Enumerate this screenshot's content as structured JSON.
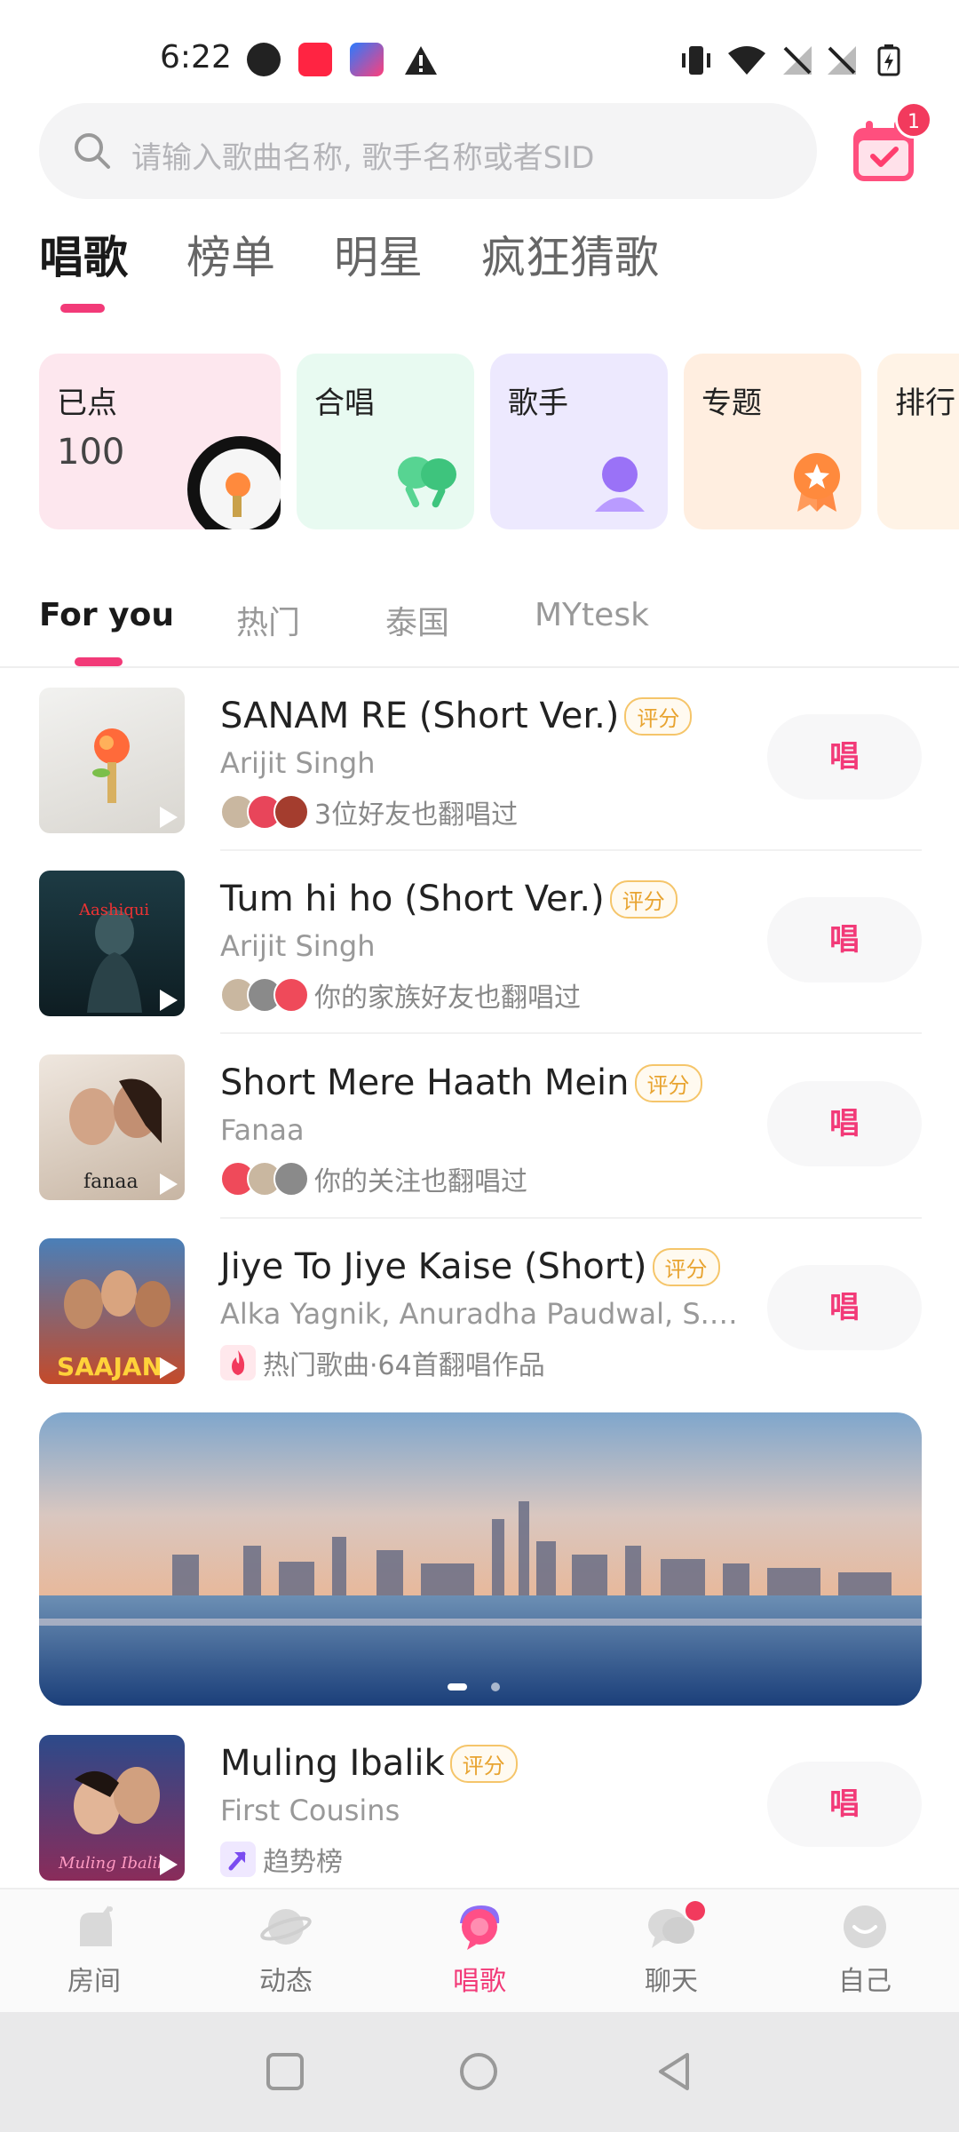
{
  "status_bar": {
    "time": "6:22"
  },
  "search": {
    "placeholder": "请输入歌曲名称, 歌手名称或者SID"
  },
  "calendar": {
    "badge": "1"
  },
  "main_tabs": [
    "唱歌",
    "榜单",
    "明星",
    "疯狂猜歌"
  ],
  "categories": [
    {
      "label": "已点",
      "count": "100"
    },
    {
      "label": "合唱"
    },
    {
      "label": "歌手"
    },
    {
      "label": "专题"
    },
    {
      "label": "排行"
    }
  ],
  "sub_tabs": [
    "For you",
    "热门",
    "泰国",
    "MYtesk"
  ],
  "songs": [
    {
      "title": "SANAM RE (Short Ver.)",
      "badge": "评分",
      "artist": "Arijit Singh",
      "meta": "3位好友也翻唱过",
      "action": "唱"
    },
    {
      "title": "Tum hi ho (Short Ver.)",
      "badge": "评分",
      "artist": "Arijit Singh",
      "meta": "你的家族好友也翻唱过",
      "action": "唱"
    },
    {
      "title": "Short Mere Haath Mein",
      "badge": "评分",
      "artist": "Fanaa",
      "meta": "你的关注也翻唱过",
      "action": "唱"
    },
    {
      "title": "Jiye To Jiye Kaise (Short)",
      "badge": "评分",
      "artist": "Alka Yagnik, Anuradha Paudwal, S. P. ...",
      "meta": "热门歌曲·64首翻唱作品",
      "action": "唱"
    },
    {
      "title": "Muling Ibalik",
      "badge": "评分",
      "artist": "First Cousins",
      "meta": "趋势榜",
      "action": "唱"
    }
  ],
  "bottom_nav": [
    "房间",
    "动态",
    "唱歌",
    "聊天",
    "自己"
  ],
  "colors": {
    "accent": "#f23a78",
    "badge_gold": "#e8a431"
  }
}
